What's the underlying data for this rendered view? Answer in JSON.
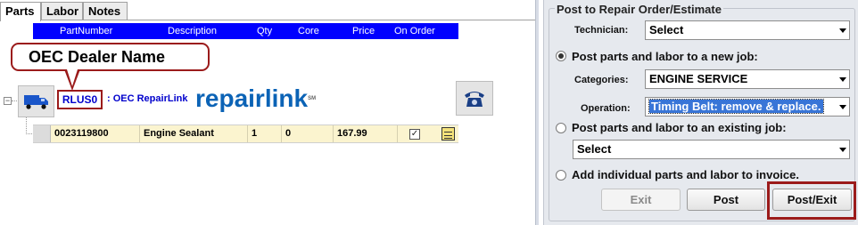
{
  "tabs": [
    {
      "label": "Parts"
    },
    {
      "label": "Labor"
    },
    {
      "label": "Notes"
    }
  ],
  "grid": {
    "columns": [
      "PartNumber",
      "Description",
      "Qty",
      "Core",
      "Price",
      "On Order"
    ]
  },
  "callout": {
    "text": "OEC Dealer Name"
  },
  "dealer": {
    "code": "RLUS0",
    "name": ": OEC RepairLink",
    "logo_text": "repairlink",
    "logo_tm": "SM"
  },
  "part": {
    "part_number": "0023119800",
    "description": "Engine Sealant",
    "qty": "1",
    "core": "0",
    "price": "167.99",
    "on_order": true
  },
  "post_panel": {
    "title": "Post to Repair Order/Estimate",
    "technician_label": "Technician:",
    "technician_value": "Select",
    "option_new_job": "Post parts and labor to a new job:",
    "categories_label": "Categories:",
    "categories_value": "ENGINE SERVICE",
    "operation_label": "Operation:",
    "operation_value": "Timing Belt: remove & replace.",
    "option_existing_job": "Post parts and labor to an existing job:",
    "existing_job_value": "Select",
    "option_individual": "Add individual parts and labor to invoice.",
    "selected_option": "new_job"
  },
  "buttons": {
    "exit": "Exit",
    "post": "Post",
    "post_exit": "Post/Exit"
  },
  "colors": {
    "grid_header": "#0000ff",
    "highlight_frame": "#9b1b1b",
    "part_row": "#fbf4cf",
    "dealer_text": "#0000cc"
  }
}
